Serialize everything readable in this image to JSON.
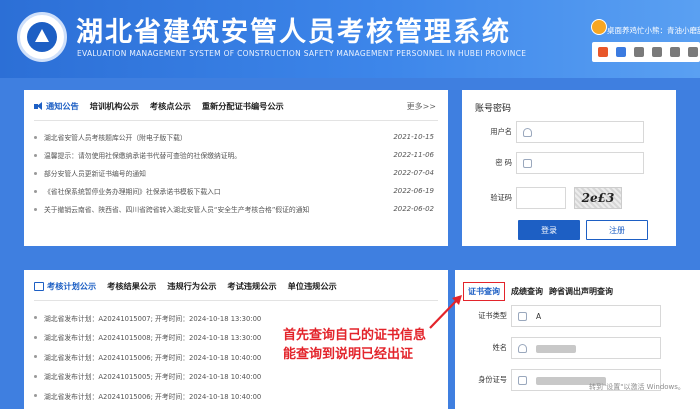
{
  "header": {
    "title": "湖北省建筑安管人员考核管理系统",
    "subtitle": "EVALUATION MANAGEMENT SYSTEM OF CONSTRUCTION SAFETY MANAGEMENT PERSONNEL IN HUBEI PROVINCE",
    "tray_text": "桌面养鸡忙小熊：青油小磨甜粥"
  },
  "notice": {
    "tabs": [
      "通知公告",
      "培训机构公示",
      "考核点公示",
      "重新分配证书编号公示"
    ],
    "more": "更多>>",
    "items": [
      {
        "text": "湖北省安管人员考核题库公开（附电子版下载）",
        "date": "2021-10-15"
      },
      {
        "text": "温馨提示：请勿使用社保缴纳承诺书代替可查验的社保缴纳证明。",
        "date": "2022-11-06"
      },
      {
        "text": "部分安管人员更新证书编号的通知",
        "date": "2022-07-04"
      },
      {
        "text": "《省社保系统暂停业务办理期间》社保承诺书模板下载入口",
        "date": "2022-06-19"
      },
      {
        "text": "关于撤销云南省、陕西省、四川省跨省转入湖北安管人员“安全生产考核合格”假证的通知",
        "date": "2022-06-02"
      }
    ]
  },
  "login": {
    "title": "账号密码",
    "username_label": "用户名",
    "password_label": "密 码",
    "captcha_label": "验证码",
    "captcha_text": "2e£3",
    "login_button": "登录",
    "register_button": "注册"
  },
  "exam": {
    "tabs": [
      "考核计划公示",
      "考核结果公示",
      "违规行为公示",
      "考试违规公示",
      "单位违规公示"
    ],
    "items": [
      "湖北省发布计划：A20241015007; 开考时间：2024-10-18 13:30:00",
      "湖北省发布计划：A20241015008; 开考时间：2024-10-18 13:30:00",
      "湖北省发布计划：A20241015006; 开考时间：2024-10-18 10:40:00",
      "湖北省发布计划：A20241015005; 开考时间：2024-10-18 10:40:00",
      "湖北省发布计划：A20241015006; 开考时间：2024-10-18 10:40:00"
    ]
  },
  "query": {
    "tabs": [
      "证书查询",
      "成绩查询",
      "跨省调出声明查询"
    ],
    "cert_type_label": "证书类型",
    "cert_type_value": "A",
    "name_label": "姓名",
    "id_label": "身份证号",
    "watermark": "转到\"设置\"以激活 Windows。"
  },
  "annotation": {
    "line1": "首先查询自己的证书信息",
    "line2": "能查询到说明已经出证"
  }
}
